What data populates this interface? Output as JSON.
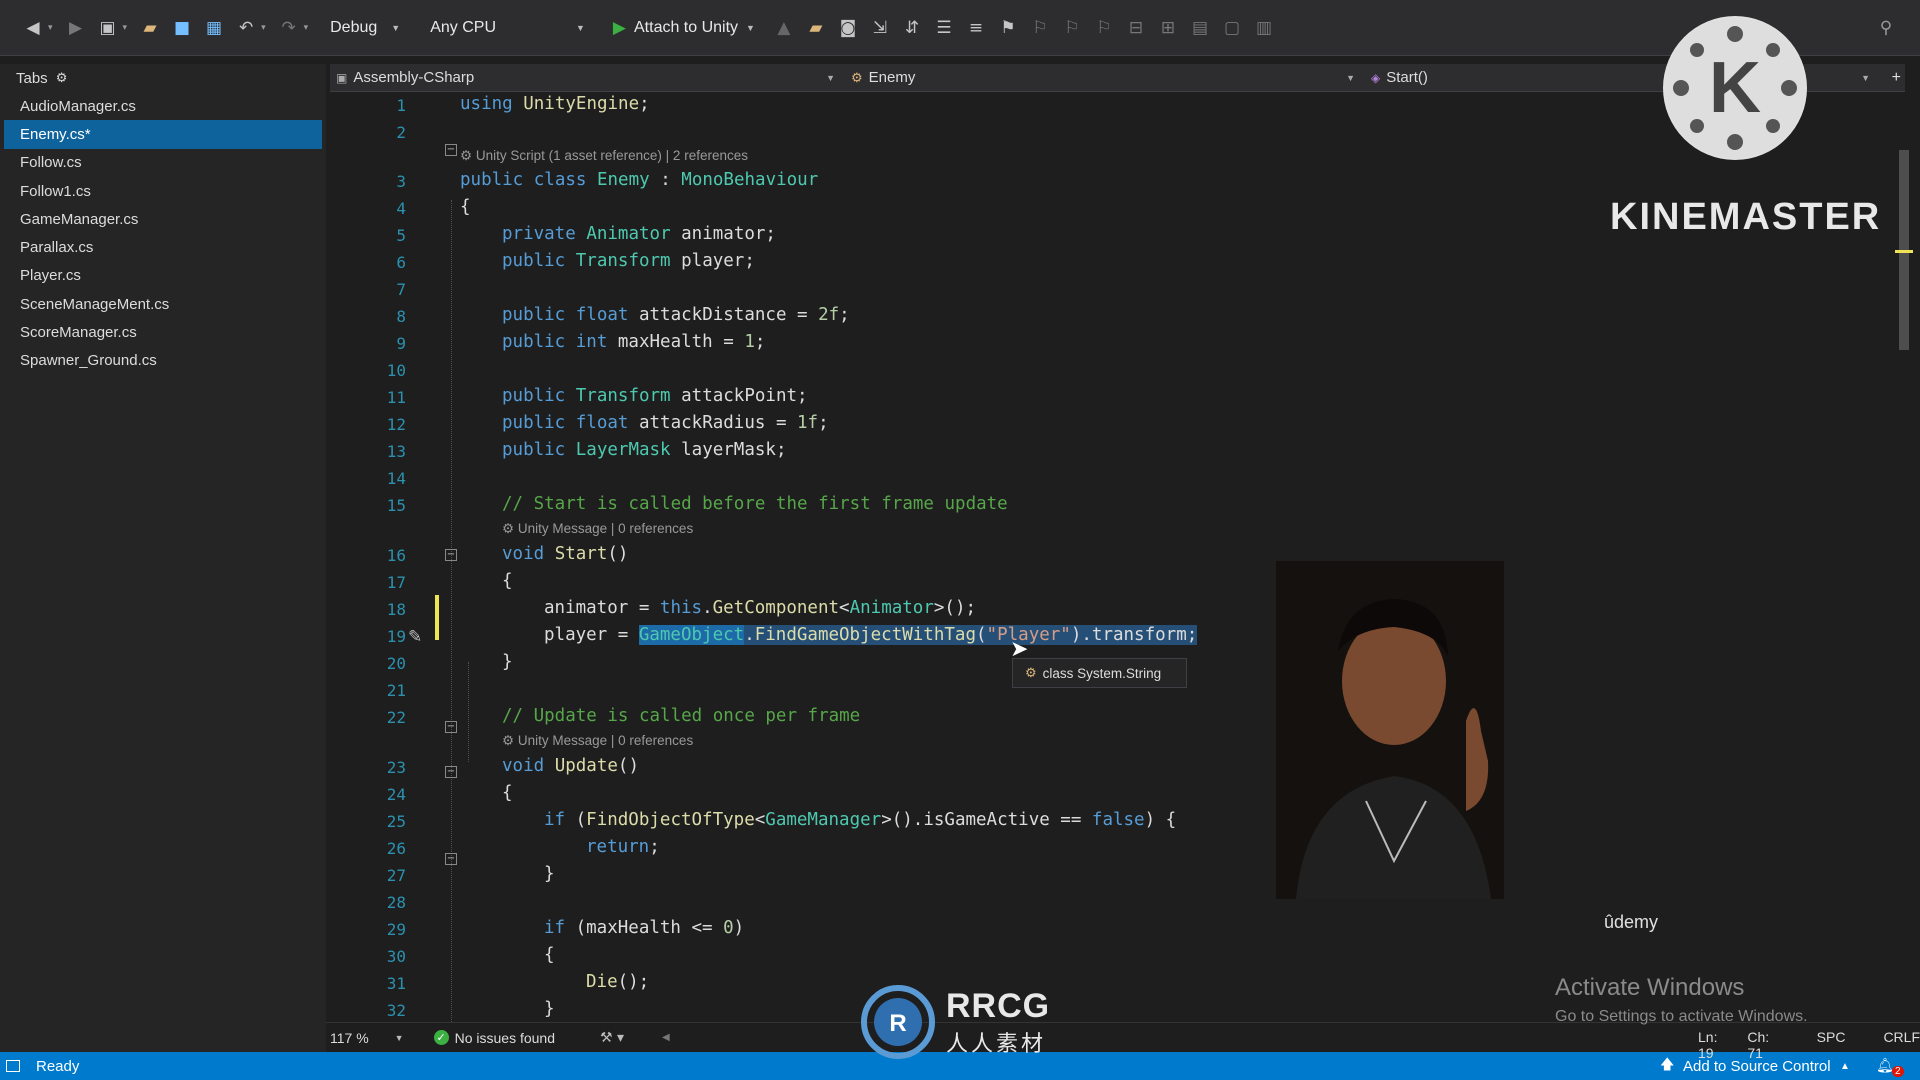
{
  "toolbar": {
    "config": "Debug",
    "platform": "Any CPU",
    "attach": "Attach to Unity"
  },
  "tabs_panel": {
    "title": "Tabs",
    "files": [
      {
        "name": "AudioManager.cs",
        "active": false
      },
      {
        "name": "Enemy.cs*",
        "active": true
      },
      {
        "name": "Follow.cs",
        "active": false
      },
      {
        "name": "Follow1.cs",
        "active": false
      },
      {
        "name": "GameManager.cs",
        "active": false
      },
      {
        "name": "Parallax.cs",
        "active": false
      },
      {
        "name": "Player.cs",
        "active": false
      },
      {
        "name": "SceneManageMent.cs",
        "active": false
      },
      {
        "name": "ScoreManager.cs",
        "active": false
      },
      {
        "name": "Spawner_Ground.cs",
        "active": false
      }
    ]
  },
  "nav": {
    "project": "Assembly-CSharp",
    "class": "Enemy",
    "member": "Start()"
  },
  "editor": {
    "line_numbers": [
      "1",
      "2",
      "3",
      "4",
      "5",
      "6",
      "7",
      "8",
      "9",
      "10",
      "11",
      "12",
      "13",
      "14",
      "15",
      "16",
      "17",
      "18",
      "19",
      "20",
      "21",
      "22",
      "23",
      "24",
      "25",
      "26",
      "27",
      "28",
      "29",
      "30",
      "31",
      "32"
    ],
    "codelens": {
      "class": "Unity Script (1 asset reference) | 2 references",
      "start": "Unity Message | 0 references",
      "update": "Unity Message | 0 references"
    },
    "tooltip": "class System.String"
  },
  "editor_status": {
    "zoom": "117 %",
    "issues": "No issues found"
  },
  "statusbar": {
    "state": "Ready",
    "line": "Ln: 19",
    "col": "Ch: 71",
    "spc": "SPC",
    "crlf": "CRLF",
    "source_control": "Add to Source Control",
    "notifications": "2"
  },
  "overlays": {
    "kinemaster": "KINEMASTER",
    "kinemaster_letter": "K",
    "udemy": "ûdemy",
    "activate_title": "Activate Windows",
    "activate_sub": "Go to Settings to activate Windows.",
    "rrcg": "RRCG",
    "rrcg_sub": "人人素材"
  },
  "colors": {
    "accent": "#007acc",
    "selection": "#0e639c",
    "keyword": "#569cd6",
    "type": "#4ec9b0",
    "comment": "#57a64a"
  }
}
